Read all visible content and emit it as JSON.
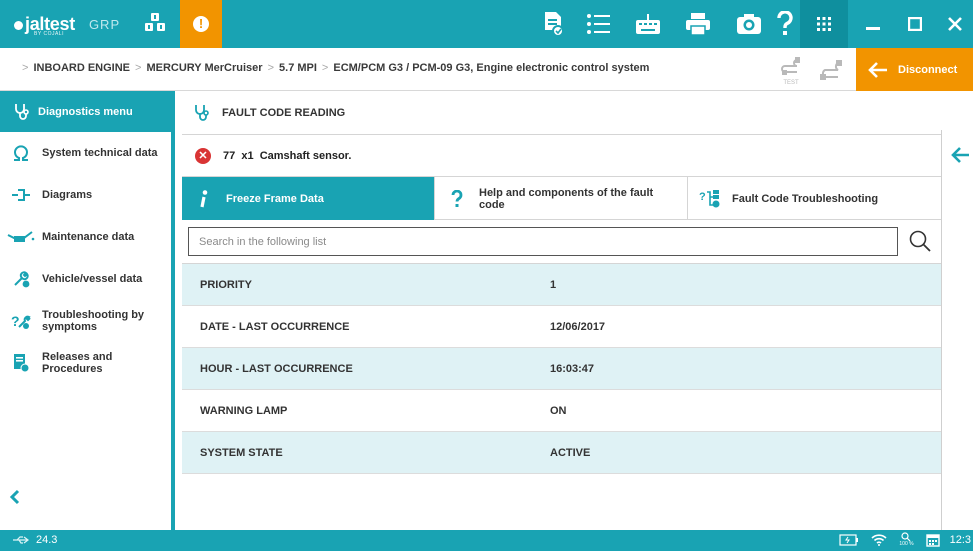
{
  "app": {
    "brand": "jaltest",
    "brand_sub": "BY COJALI",
    "brand_group": "GRP",
    "accent_color": "#19a3b3",
    "warning_color": "#f29400"
  },
  "toolbar": {
    "icons": [
      "report-icon",
      "list-icon",
      "keyboard-icon",
      "print-icon",
      "camera-icon",
      "help-icon",
      "apps-grid-icon"
    ],
    "window_controls": [
      "minimize-icon",
      "maximize-icon",
      "close-icon"
    ]
  },
  "breadcrumb": {
    "items": [
      "INBOARD ENGINE",
      "MERCURY MerCruiser",
      "5.7 MPI",
      "ECM/PCM G3 / PCM-09 G3, Engine electronic control system"
    ],
    "test_label": "TEST",
    "disconnect_label": "Disconnect"
  },
  "sidebar": {
    "header": "Diagnostics menu",
    "items": [
      {
        "label": "System technical data",
        "icon": "omega-icon"
      },
      {
        "label": "Diagrams",
        "icon": "diagram-icon"
      },
      {
        "label": "Maintenance data",
        "icon": "oil-can-icon"
      },
      {
        "label": "Vehicle/vessel data",
        "icon": "wrench-globe-icon"
      },
      {
        "label": "Troubleshooting by symptoms",
        "icon": "troubleshoot-icon"
      },
      {
        "label": "Releases and Procedures",
        "icon": "document-globe-icon"
      }
    ]
  },
  "main": {
    "title": "FAULT CODE READING",
    "fault": "77  x1  Camshaft sensor.",
    "tabs": [
      {
        "label": "Freeze Frame Data",
        "icon": "info-icon",
        "active": true
      },
      {
        "label": "Help and components of the fault code",
        "icon": "question-icon",
        "active": false
      },
      {
        "label": "Fault Code Troubleshooting",
        "icon": "flowchart-icon",
        "active": false
      }
    ],
    "search_placeholder": "Search in the following list",
    "rows": [
      {
        "key": "PRIORITY",
        "value": "1"
      },
      {
        "key": "DATE - LAST OCCURRENCE",
        "value": "12/06/2017"
      },
      {
        "key": "HOUR - LAST OCCURRENCE",
        "value": "16:03:47"
      },
      {
        "key": "WARNING LAMP",
        "value": "ON"
      },
      {
        "key": "SYSTEM STATE",
        "value": "ACTIVE"
      }
    ]
  },
  "statusbar": {
    "voltage": "24.3",
    "zoom": "100 %",
    "time": "12:3"
  }
}
